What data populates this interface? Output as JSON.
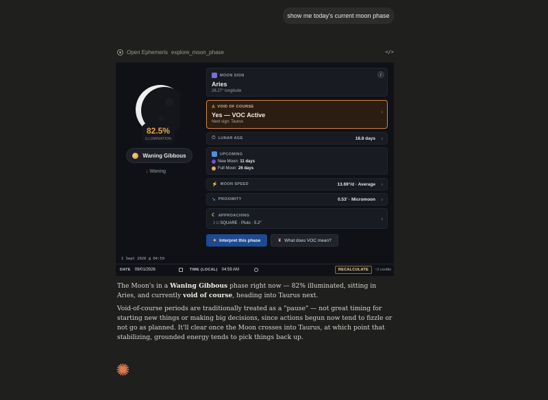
{
  "user_message": "show me today's current moon phase",
  "tool": {
    "server": "Open Ephemeris",
    "function": "explore_moon_phase",
    "code_icon": "</>"
  },
  "widget": {
    "illumination_value": "82.5%",
    "illumination_label": "ILLUMINATION",
    "phase_name": "Waning Gibbous",
    "direction": "Waning",
    "info_icon": "i",
    "moon_sign": {
      "label": "MOON SIGN",
      "value": "Aries",
      "detail": "28.27° longitude"
    },
    "voc": {
      "label": "VOID OF COURSE",
      "value": "Yes — VOC Active",
      "detail": "Next sign: Taurus"
    },
    "lunar_age": {
      "label": "LUNAR AGE",
      "value": "18.8 days"
    },
    "upcoming": {
      "label": "UPCOMING",
      "new_moon_label": "New Moon:",
      "new_moon_value": "11 days",
      "full_moon_label": "Full Moon:",
      "full_moon_value": "26 days"
    },
    "moon_speed": {
      "label": "MOON SPEED",
      "value": "13.69°/d · Average"
    },
    "proximity": {
      "label": "PROXIMITY",
      "value": "0.53' · Micromoon"
    },
    "approaching": {
      "label": "APPROACHING",
      "value": "☽ □ SQUARE · Pluto · 5.2°"
    },
    "buttons": {
      "interpret": "Interpret this phase",
      "voc_mean": "What does VOC mean?"
    },
    "date_stamp": "1 Sept 2026 @ 04:59",
    "date_label": "DATE",
    "date_value": "09/01/2026",
    "time_label": "TIME (LOCAL)",
    "time_value": "04:59 AM",
    "recalculate": "RECALCULATE",
    "credits": "~3 credits"
  },
  "reply": {
    "p1_a": "The Moon's in a ",
    "p1_b": "Waning Gibbous",
    "p1_c": " phase right now — 82% illuminated, sitting in Aries, and currently ",
    "p1_d": "void of course",
    "p1_e": ", heading into Taurus next.",
    "p2": "Void-of-course periods are traditionally treated as a \"pause\" — not great timing for starting new things or making big decisions, since actions begun now tend to fizzle or not go as planned. It'll clear once the Moon crosses into Taurus, at which point that stabilizing, grounded energy tends to pick things back up."
  },
  "colors": {
    "accent_orange": "#e8a64a",
    "voc_border": "#d9873e",
    "button_blue": "#1e4a8f",
    "spark": "#e07a4f"
  }
}
